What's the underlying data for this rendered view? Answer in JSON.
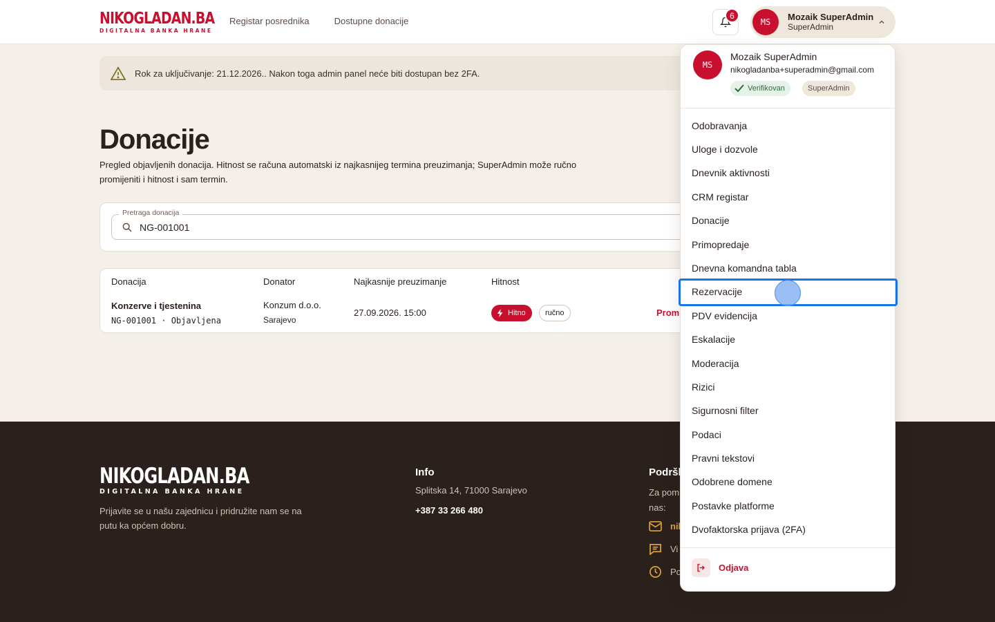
{
  "header": {
    "logo_main_a": "NIKO",
    "logo_main_b": "GLADAN.BA",
    "logo_sub": "DIGITALNA BANKA HRANE",
    "nav": [
      "Registar posrednika",
      "Dostupne donacije"
    ],
    "notification_count": "6",
    "user_initials": "MS",
    "user_name": "Mozaik SuperAdmin",
    "user_role": "SuperAdmin"
  },
  "alert": {
    "text": "Rok za uključivanje: 21.12.2026.. Nakon toga admin panel neće biti dostupan bez 2FA."
  },
  "page": {
    "title": "Donacije",
    "description": "Pregled objavljenih donacija. Hitnost se računa automatski iz najkasnijeg termina preuzimanja; SuperAdmin može ručno promijeniti i hitnost i sam termin."
  },
  "search": {
    "label": "Pretraga donacija",
    "value": "NG-001001"
  },
  "table": {
    "headers": [
      "Donacija",
      "Donator",
      "Najkasnije preuzimanje",
      "Hitnost"
    ],
    "rows": [
      {
        "title": "Konzerve i tjestenina",
        "code": "NG-001001 · Objavljena",
        "donor": "Konzum d.o.o.",
        "city": "Sarajevo",
        "deadline": "27.09.2026. 15:00",
        "urgency": "Hitno",
        "mode": "ručno",
        "action": "Promi"
      }
    ]
  },
  "footer": {
    "logo_main": "NIKOGLADAN.BA",
    "logo_sub": "DIGITALNA BANKA HRANE",
    "tagline": "Prijavite se u našu zajednicu i pridružite nam se na putu ka općem dobru.",
    "info_title": "Info",
    "address": "Splitska 14, 71000 Sarajevo",
    "phone": "+387 33 266 480",
    "support_title": "Podršk",
    "support_text": "Za pom nas:",
    "contact_email": "nil",
    "contact_chat": "Vi",
    "contact_hours": "Po"
  },
  "dropdown": {
    "initials": "MS",
    "name": "Mozaik SuperAdmin",
    "email": "nikogladanba+superadmin@gmail.com",
    "verified": "Verifikovan",
    "role": "SuperAdmin",
    "items": [
      "Odobravanja",
      "Uloge i dozvole",
      "Dnevnik aktivnosti",
      "CRM registar",
      "Donacije",
      "Primopredaje",
      "Dnevna komandna tabla",
      "Rezervacije",
      "PDV evidencija",
      "Eskalacije",
      "Moderacija",
      "Rizici",
      "Sigurnosni filter",
      "Podaci",
      "Pravni tekstovi",
      "Odobrene domene",
      "Postavke platforme",
      "Dvofaktorska prijava (2FA)"
    ],
    "logout": "Odjava"
  },
  "colors": {
    "brand_red": "#c8102e",
    "footer_bg": "#2a201c",
    "page_bg": "#f4efe9",
    "highlight": "#1a73e8",
    "footer_accent": "#e0a23a"
  }
}
